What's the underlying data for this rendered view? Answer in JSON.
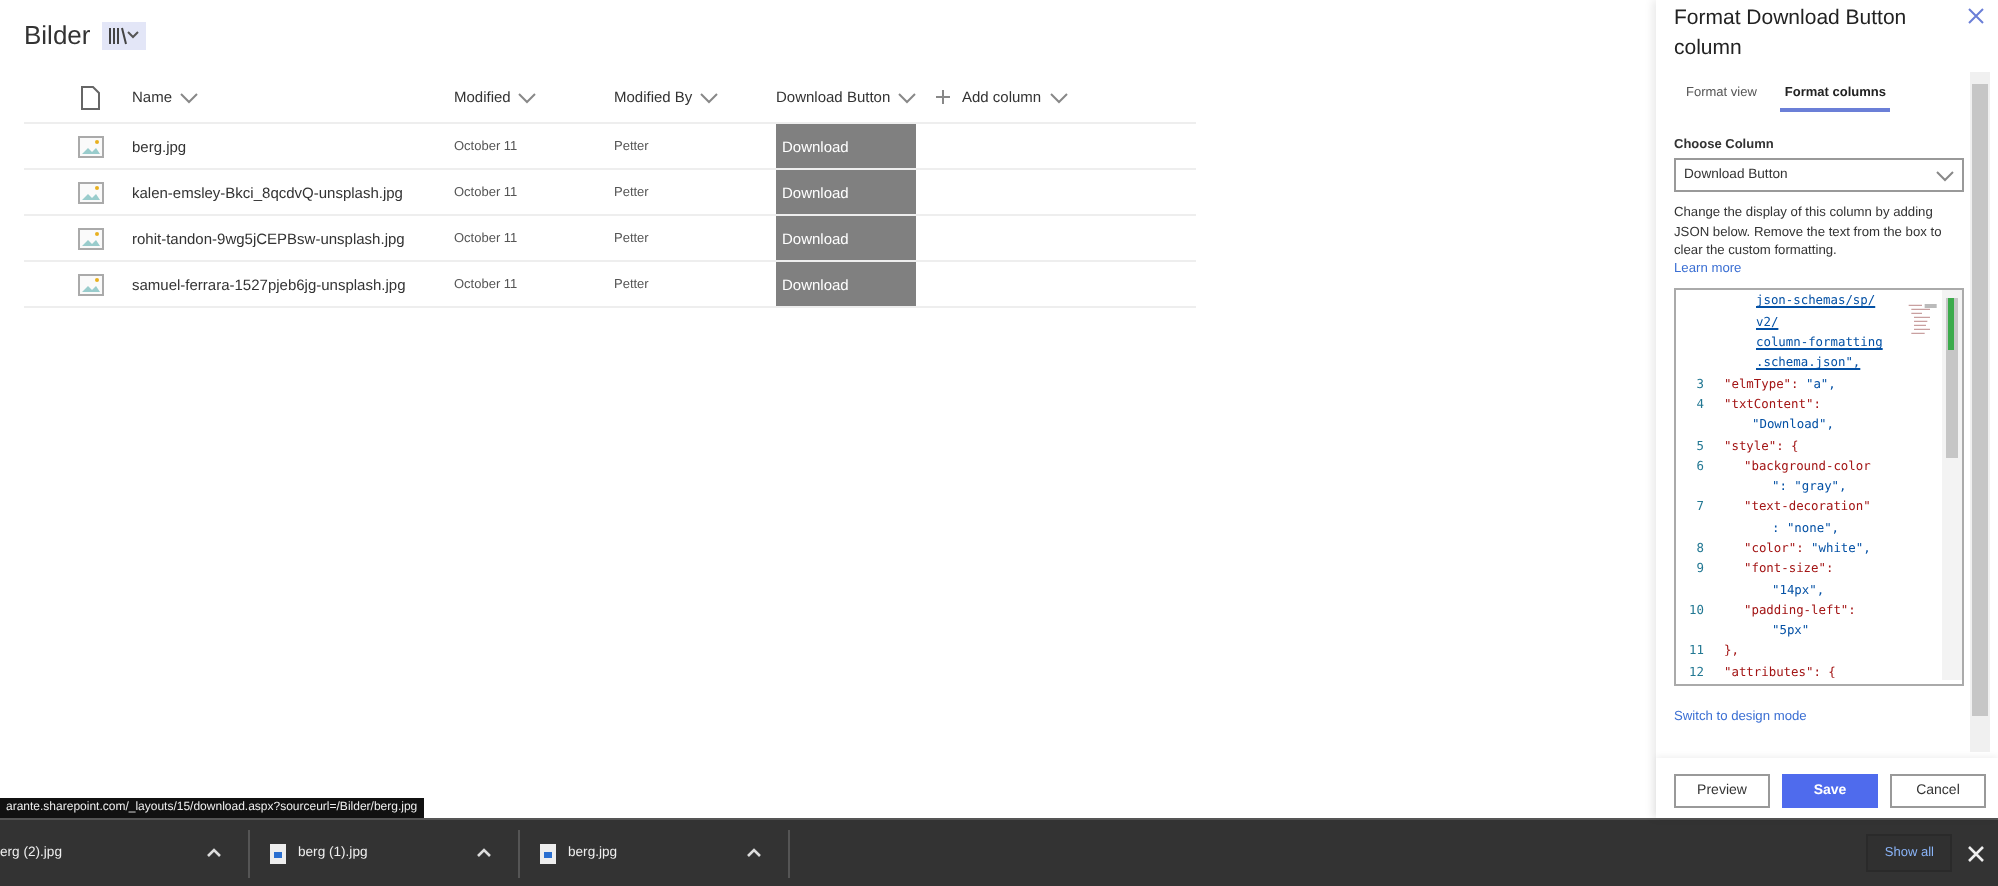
{
  "library": {
    "title": "Bilder"
  },
  "table": {
    "columns": [
      "Name",
      "Modified",
      "Modified By",
      "Download Button"
    ],
    "add_column": "Add column",
    "rows": [
      {
        "name": "berg.jpg",
        "modified": "October 11",
        "modified_by": "Petter",
        "action": "Download"
      },
      {
        "name": "kalen-emsley-Bkci_8qcdvQ-unsplash.jpg",
        "modified": "October 11",
        "modified_by": "Petter",
        "action": "Download"
      },
      {
        "name": "rohit-tandon-9wg5jCEPBsw-unsplash.jpg",
        "modified": "October 11",
        "modified_by": "Petter",
        "action": "Download"
      },
      {
        "name": "samuel-ferrara-1527pjeb6jg-unsplash.jpg",
        "modified": "October 11",
        "modified_by": "Petter",
        "action": "Download"
      }
    ]
  },
  "panel": {
    "title": "Format Download Button column",
    "tabs": [
      {
        "label": "Format view",
        "selected": false
      },
      {
        "label": "Format columns",
        "selected": true
      }
    ],
    "choose_label": "Choose Column",
    "column_value": "Download Button",
    "description": "Change the display of this column by adding JSON below. Remove the text from the box to clear the custom formatting.",
    "learn_more": "Learn more",
    "code_lines": [
      {
        "kind": "link",
        "value": "json-schemas/sp/"
      },
      {
        "kind": "link",
        "value": "v2/"
      },
      {
        "kind": "link",
        "value": "column-formatting"
      },
      {
        "kind": "link",
        "value": ".schema.json\","
      },
      {
        "kind": "prop",
        "number": "3",
        "key": "\"elmType\": ",
        "value": "\"a\","
      },
      {
        "kind": "prop",
        "number": "4",
        "key": "\"txtContent\":"
      },
      {
        "kind": "cont",
        "value": "\"Download\","
      },
      {
        "kind": "prop",
        "number": "5",
        "key": "\"style\": {"
      },
      {
        "kind": "inner",
        "number": "6",
        "key": "\"background-color"
      },
      {
        "kind": "innercont",
        "value": "\": \"gray\","
      },
      {
        "kind": "inner",
        "number": "7",
        "key": "\"text-decoration\""
      },
      {
        "kind": "innercont",
        "value": ": \"none\","
      },
      {
        "kind": "inner",
        "number": "8",
        "key": "\"color\": ",
        "value": "\"white\","
      },
      {
        "kind": "inner",
        "number": "9",
        "key": "\"font-size\":"
      },
      {
        "kind": "innercont",
        "value": "\"14px\","
      },
      {
        "kind": "inner",
        "number": "10",
        "key": "\"padding-left\":"
      },
      {
        "kind": "innercont",
        "value": "\"5px\""
      },
      {
        "kind": "prop",
        "number": "11",
        "key": "},"
      },
      {
        "kind": "prop",
        "number": "12",
        "key": "\"attributes\": {"
      }
    ],
    "design_link": "Switch to design mode",
    "buttons": [
      {
        "label": "Preview",
        "kind": "secondary"
      },
      {
        "label": "Save",
        "kind": "primary"
      },
      {
        "label": "Cancel",
        "kind": "secondary"
      }
    ]
  },
  "status_url": "arante.sharepoint.com/_layouts/15/download.aspx?sourceurl=/Bilder/berg.jpg",
  "downloads": {
    "items": [
      {
        "name": "erg (2).jpg",
        "icon": false
      },
      {
        "name": "berg (1).jpg",
        "icon": true
      },
      {
        "name": "berg.jpg",
        "icon": true
      }
    ],
    "show_all": "Show all"
  }
}
